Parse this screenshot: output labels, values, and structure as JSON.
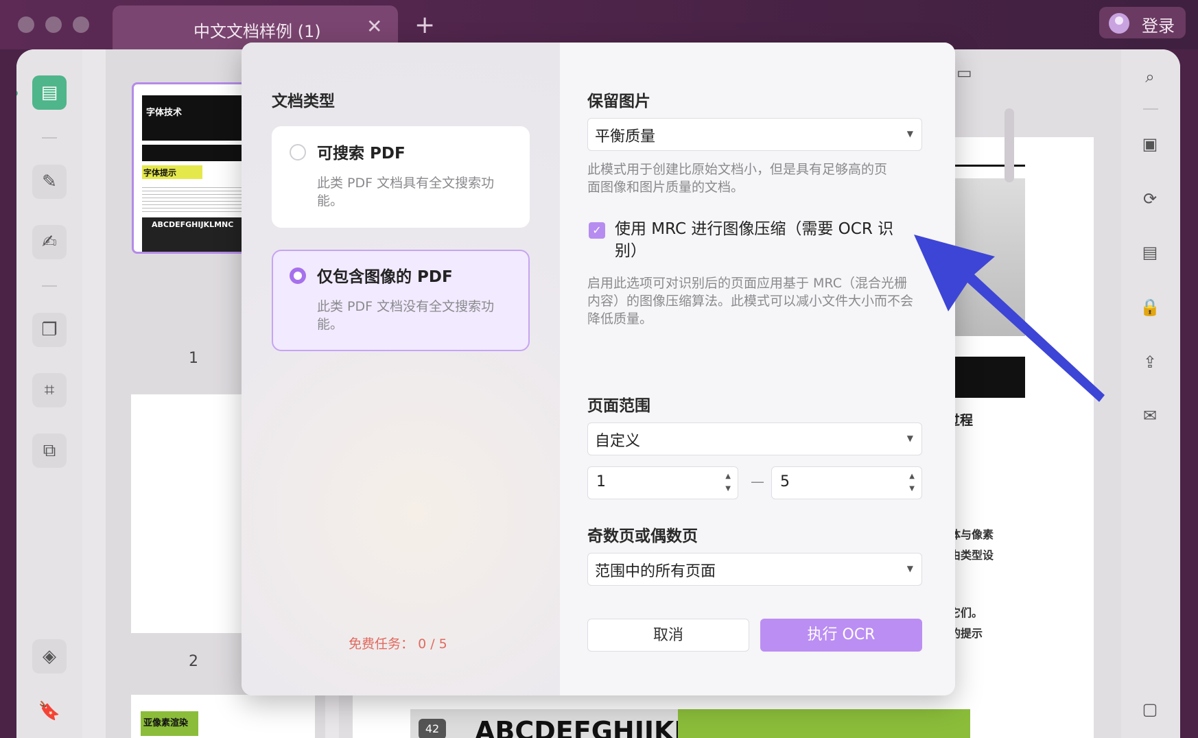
{
  "window": {
    "tab_title": "中文文档样例 (1)",
    "close_tab": "✕",
    "new_tab": "+",
    "login_label": "登录"
  },
  "thumbnails": {
    "page1_number": "1",
    "page2_number": "2",
    "page1_heading": "字体技术",
    "page1_sub": "字体提示",
    "page1_sample": "ABCDEFGHIJKLMNC",
    "page3_heading": "亚像素渲染"
  },
  "document_fragments": {
    "line1": "到交付的过程",
    "line2": "指令表将字体与像素",
    "line3": "于该过程将由类型设",
    "line4": "素边界对齐它们。",
    "line5": "和编辑字体的提示",
    "bottom_banner": "ABCDEFGHIJKLMNC",
    "bottom_badge": "42"
  },
  "dialog": {
    "doc_type_heading": "文档类型",
    "options": [
      {
        "title": "可搜索 PDF",
        "desc": "此类 PDF 文档具有全文搜索功能。",
        "selected": false
      },
      {
        "title": "仅包含图像的 PDF",
        "desc": "此类 PDF 文档没有全文搜索功能。",
        "selected": true
      }
    ],
    "free_tasks_label": "免费任务：",
    "free_tasks_value": "0 / 5",
    "keep_images_heading": "保留图片",
    "keep_images_value": "平衡质量",
    "keep_images_hint": "此模式用于创建比原始文档小，但是具有足够高的页面图像和图片质量的文档。",
    "mrc_label": "使用 MRC 进行图像压缩（需要 OCR 识别）",
    "mrc_checked": true,
    "mrc_hint": "启用此选项可对识别后的页面应用基于 MRC（混合光栅内容）的图像压缩算法。此模式可以减小文件大小而不会降低质量。",
    "page_range_heading": "页面范围",
    "page_range_value": "自定义",
    "range_from": "1",
    "range_dash": "—",
    "range_to": "5",
    "odd_even_heading": "奇数页或偶数页",
    "odd_even_value": "范围中的所有页面",
    "cancel_label": "取消",
    "run_label": "执行 OCR"
  },
  "colors": {
    "accent": "#bb8ef3",
    "selected_border": "#c6a4f2",
    "free_tasks": "#e06a5e",
    "arrow": "#3d45d6",
    "active_tool": "#4fb58a"
  }
}
